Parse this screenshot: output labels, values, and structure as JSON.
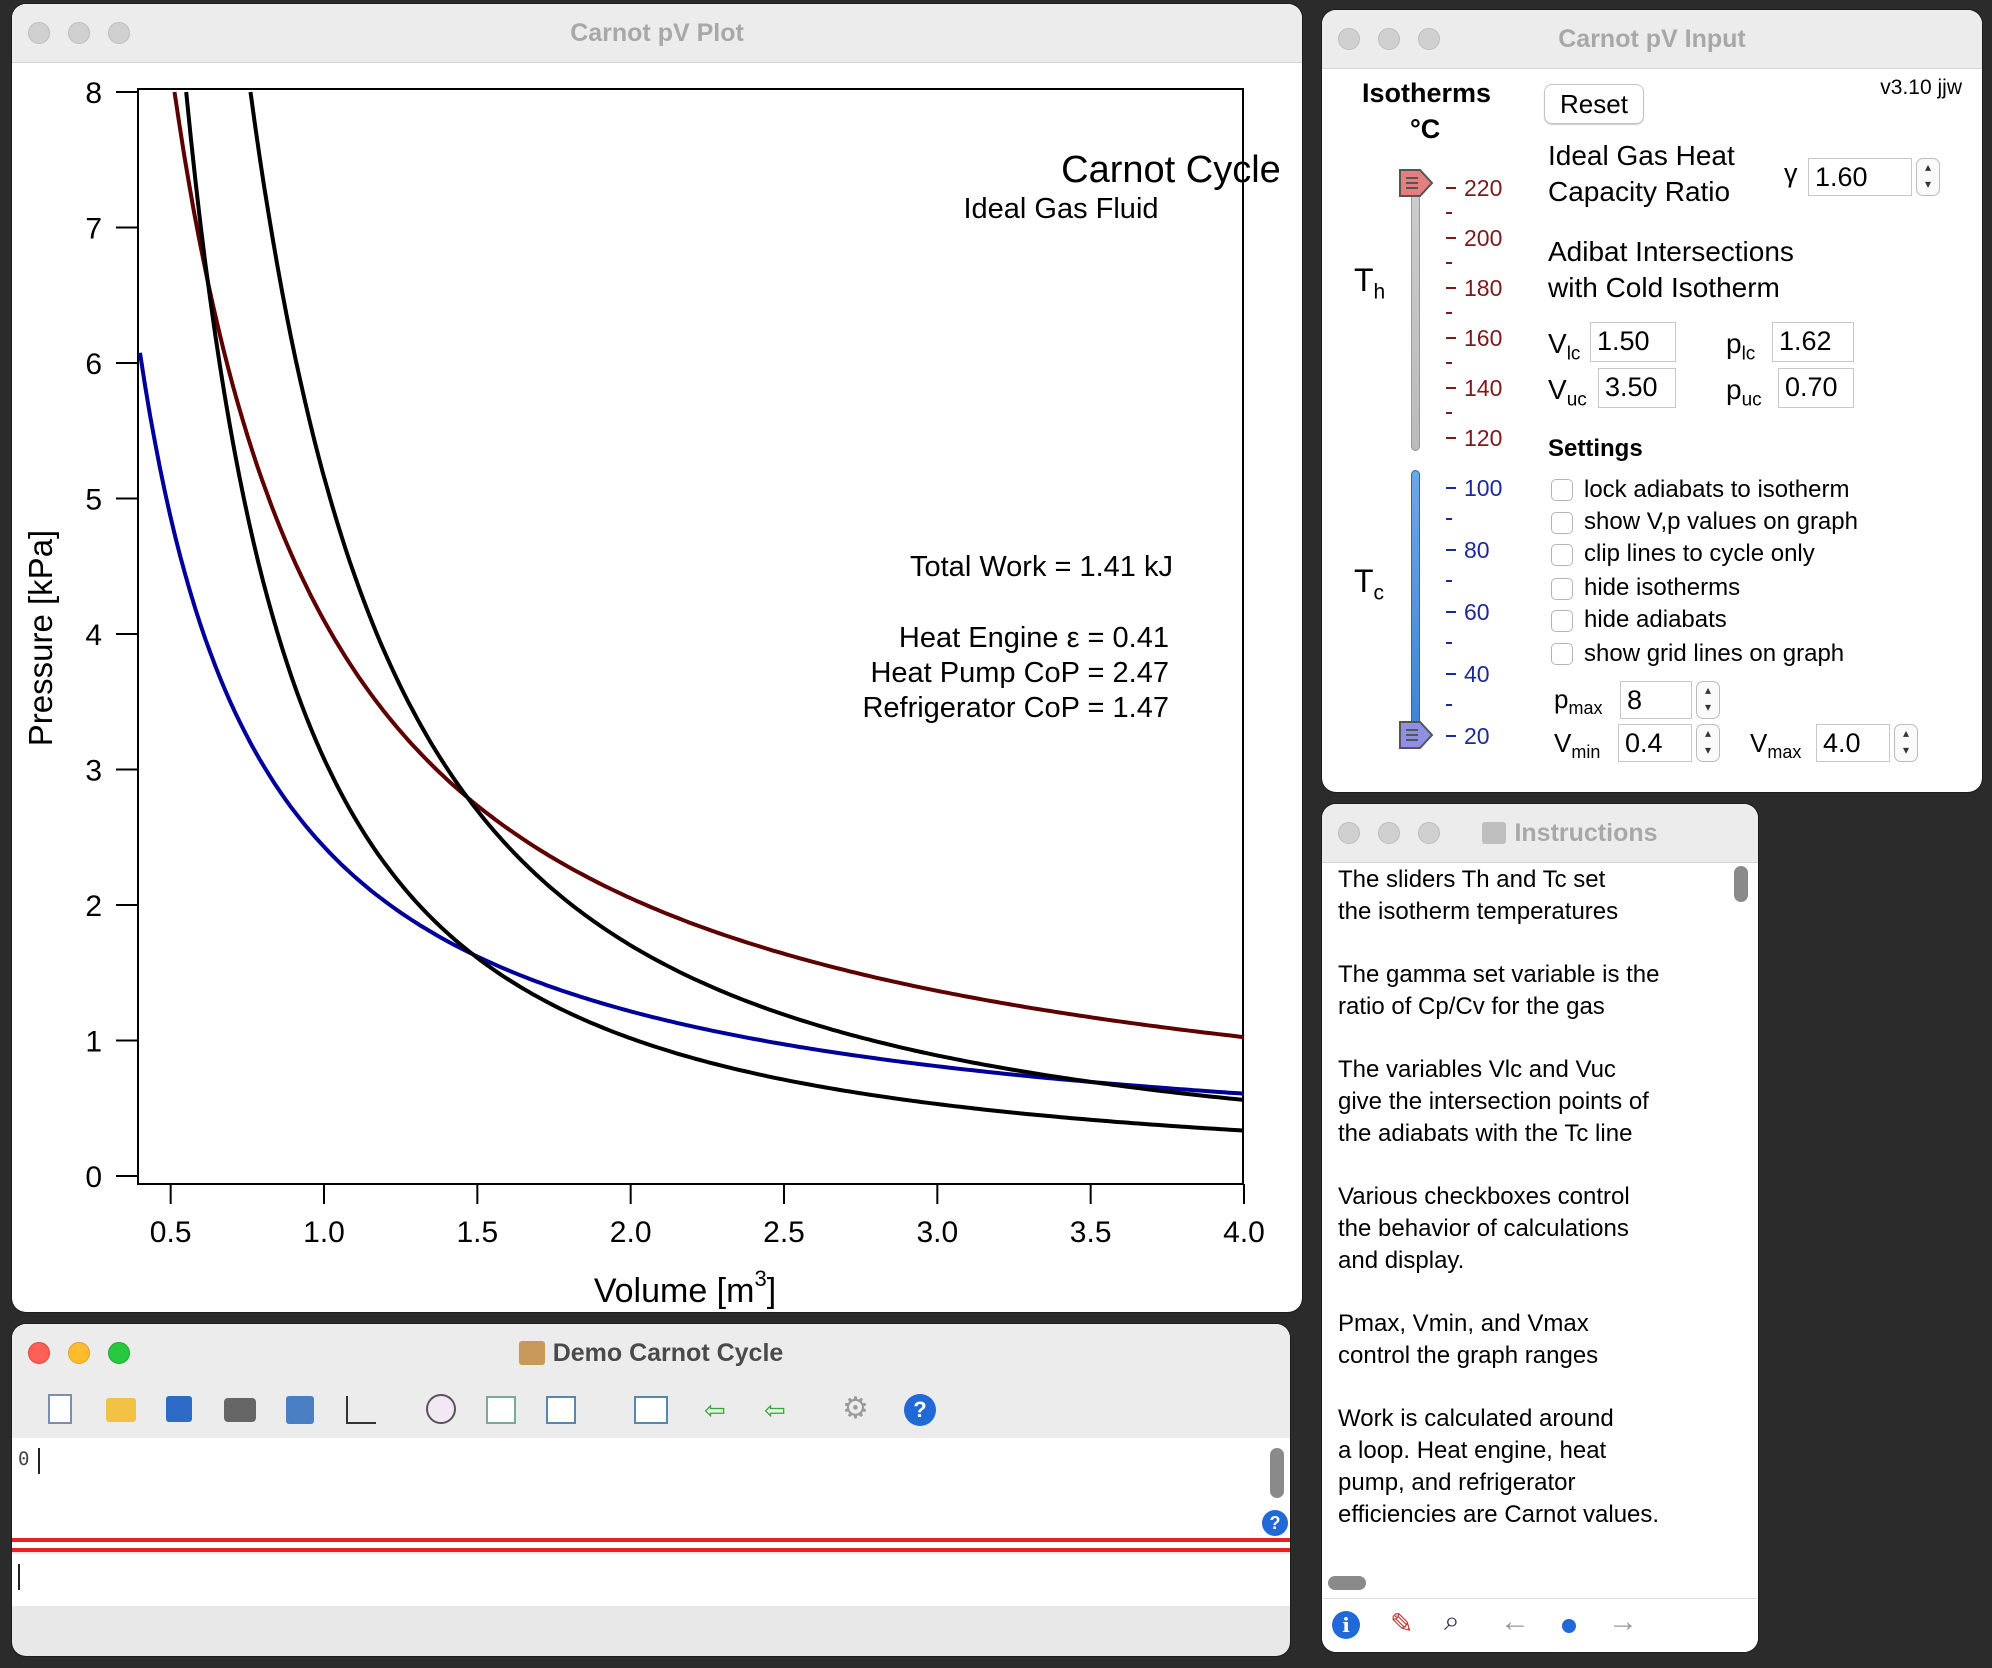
{
  "plot_window": {
    "title": "Carnot pV Plot",
    "chart_title": "Carnot Cycle",
    "chart_subtitle": "Ideal Gas Fluid",
    "total_work": "Total Work = 1.41 kJ",
    "heat_engine": "Heat Engine ε =  0.41",
    "heat_pump": "Heat Pump CoP =  2.47",
    "refrigerator": "Refrigerator CoP =  1.47",
    "ylabel": "Pressure [kPa]",
    "xlabel_main": "Volume [m",
    "xlabel_sup": "3",
    "xlabel_end": "]"
  },
  "chart_data": {
    "type": "line",
    "title": "Carnot Cycle",
    "subtitle": "Ideal Gas Fluid",
    "xlabel": "Volume [m3]",
    "ylabel": "Pressure [kPa]",
    "xlim": [
      0.4,
      4.0
    ],
    "ylim": [
      0,
      8
    ],
    "xticks": [
      "0.5",
      "1.0",
      "1.5",
      "2.0",
      "2.5",
      "3.0",
      "3.5",
      "4.0"
    ],
    "yticks": [
      "0",
      "1",
      "2",
      "3",
      "4",
      "5",
      "6",
      "7",
      "8"
    ],
    "grid": false,
    "series": [
      {
        "color": "#5c0000",
        "formula": "p = 4.10 / V",
        "x": [
          0.51,
          0.75,
          1.0,
          1.5,
          2.0,
          2.5,
          3.0,
          3.5,
          4.0
        ],
        "y": [
          8.0,
          5.47,
          4.1,
          2.73,
          2.05,
          1.64,
          1.37,
          1.17,
          1.03
        ]
      },
      {
        "color": "#000099",
        "formula": "p = 2.43 / V",
        "x": [
          0.4,
          0.75,
          1.0,
          1.5,
          2.0,
          2.5,
          3.0,
          3.5,
          4.0
        ],
        "y": [
          6.08,
          3.24,
          2.43,
          1.62,
          1.22,
          0.97,
          0.81,
          0.69,
          0.61
        ]
      },
      {
        "color": "#000000",
        "formula": "p = 3.08 / V^1.6",
        "x": [
          0.54,
          0.75,
          1.0,
          1.5,
          2.0,
          2.5,
          3.0,
          3.5,
          4.0
        ],
        "y": [
          8.0,
          4.87,
          3.08,
          1.62,
          1.02,
          0.71,
          0.53,
          0.41,
          0.34
        ]
      },
      {
        "color": "#000000",
        "formula": "p = 5.16 / V^1.6",
        "x": [
          0.76,
          1.0,
          1.5,
          2.0,
          2.5,
          3.0,
          3.5,
          4.0
        ],
        "y": [
          8.0,
          5.16,
          2.71,
          1.7,
          1.19,
          0.89,
          0.7,
          0.56
        ]
      }
    ]
  },
  "input_window": {
    "title": "Carnot pV Input",
    "version": "v3.10 jjw",
    "isotherms": "Isotherms",
    "deg": "°C",
    "th_main": "T",
    "th_sub": "h",
    "tc_main": "T",
    "tc_sub": "c",
    "reset": "Reset",
    "gamma_label_1": "Ideal Gas Heat",
    "gamma_label_2": "Capacity Ratio",
    "gamma_symbol": "γ",
    "gamma_value": "1.60",
    "adibat_1": "Adibat Intersections",
    "adibat_2": "with Cold Isotherm",
    "vlc_main": "V",
    "vlc_sub": "lc",
    "vlc_value": "1.50",
    "plc_main": "p",
    "plc_sub": "lc",
    "plc_value": "1.62",
    "vuc_main": "V",
    "vuc_sub": "uc",
    "vuc_value": "3.50",
    "puc_main": "p",
    "puc_sub": "uc",
    "puc_value": "0.70",
    "settings": "Settings",
    "checkboxes": [
      "lock adiabats to isotherm",
      "show V,p values on graph",
      "clip lines to cycle only",
      "hide isotherms",
      "hide adiabats",
      "show grid lines on graph"
    ],
    "pmax_main": "p",
    "pmax_sub": "max",
    "pmax_value": "8",
    "vmin_main": "V",
    "vmin_sub": "min",
    "vmin_value": "0.4",
    "vmax_main": "V",
    "vmax_sub": "max",
    "vmax_value": "4.0",
    "hot_ticks": [
      "220",
      "200",
      "180",
      "160",
      "140",
      "120"
    ],
    "cold_ticks": [
      "100",
      "80",
      "60",
      "40",
      "20"
    ],
    "th_value_c": 220,
    "tc_value_c": 20,
    "hot_color": "#7a1a1a",
    "cold_color": "#1a2a9a"
  },
  "instructions_window": {
    "title": "Instructions",
    "paragraphs": [
      [
        "The sliders Th and Tc set",
        "the isotherm temperatures"
      ],
      [
        "The gamma set variable is the",
        "ratio of Cp/Cv for the gas"
      ],
      [
        "The variables Vlc and Vuc",
        "give the intersection points of",
        "the adiabats with the Tc line"
      ],
      [
        "Various checkboxes control",
        "the behavior of calculations",
        "and display."
      ],
      [
        "Pmax, Vmin, and Vmax",
        "control the graph ranges"
      ],
      [
        "Work is calculated around",
        "a loop. Heat engine, heat",
        "pump, and refrigerator",
        "efficiencies are Carnot values."
      ]
    ]
  },
  "demo_window": {
    "title": "Demo Carnot Cycle",
    "history_line": "0",
    "toolbar": [
      "new-file-icon",
      "open-folder-icon",
      "save-icon",
      "print-icon",
      "save-graphics-icon",
      "new-graph-icon",
      "procedure-icon",
      "data-browser-icon",
      "preview-icon",
      "new-window-icon",
      "load-waves-icon",
      "insert-icon",
      "settings-icon",
      "help-icon"
    ]
  }
}
